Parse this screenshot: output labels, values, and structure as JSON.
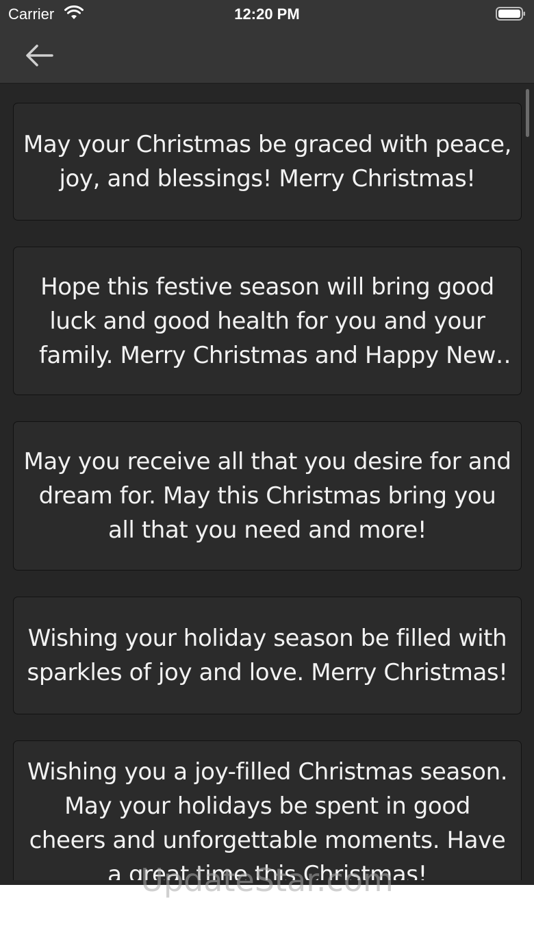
{
  "status_bar": {
    "carrier": "Carrier",
    "time": "12:20 PM"
  },
  "nav": {
    "back_icon": "arrow-left-icon"
  },
  "cards": [
    {
      "text": "May your Christmas be graced with peace, joy, and blessings! Merry Christmas!",
      "lines": 2
    },
    {
      "text": "Hope this festive season will bring good luck and good health for you and your family. Merry Christmas and Happy New Year!",
      "lines": 3
    },
    {
      "text": "May you receive all that you desire for and dream for. May this Christmas bring you all that you need and more!",
      "lines": 3
    },
    {
      "text": "Wishing your holiday season be filled with sparkles of joy and love. Merry Christmas!",
      "lines": 2
    },
    {
      "text": "Wishing you a joy-filled Christmas season. May your holidays be spent in good cheers and unforgettable moments. Have a great time this Christmas!",
      "lines": 5
    }
  ],
  "watermark": "UpdateStar.com",
  "colors": {
    "background": "#262626",
    "bar": "#363636",
    "card": "#2b2b2b",
    "text": "#f2f2f2"
  }
}
